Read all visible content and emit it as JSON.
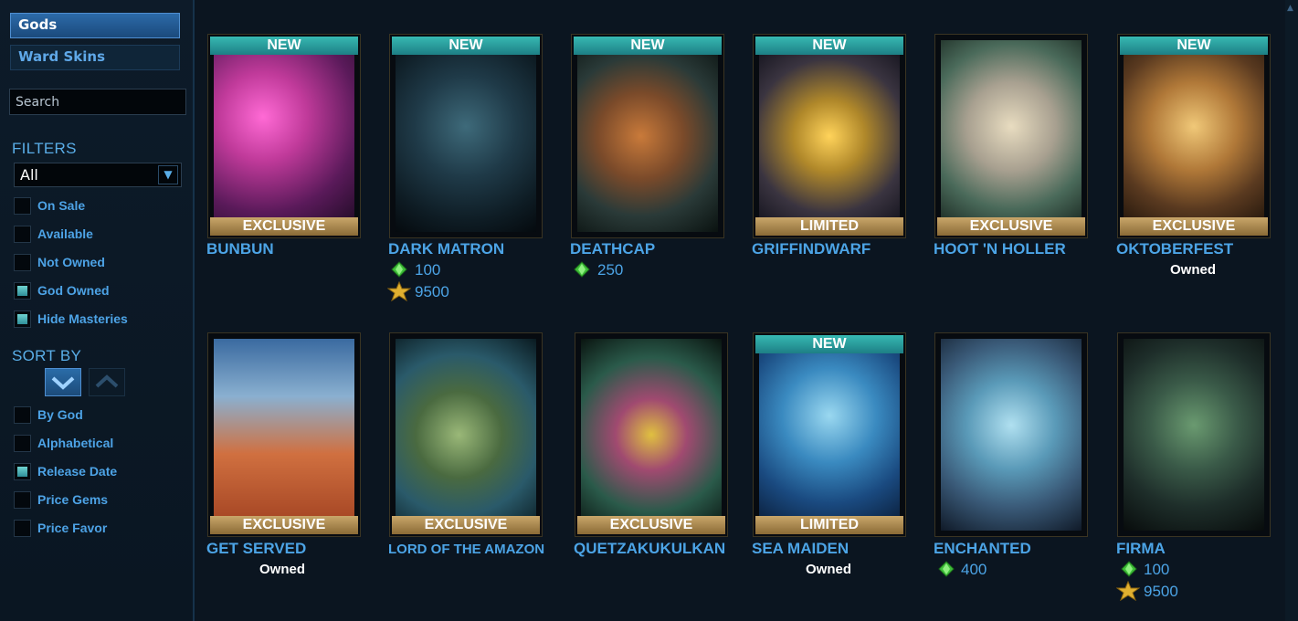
{
  "sidebar": {
    "tabs": [
      {
        "label": "Gods",
        "active": true
      },
      {
        "label": "Ward Skins",
        "active": false
      }
    ],
    "search_placeholder": "Search",
    "filters_title": "FILTERS",
    "filter_dropdown": "All",
    "filter_options": [
      {
        "label": "On Sale",
        "checked": false
      },
      {
        "label": "Available",
        "checked": false
      },
      {
        "label": "Not Owned",
        "checked": false
      },
      {
        "label": "God Owned",
        "checked": true
      },
      {
        "label": "Hide Masteries",
        "checked": true
      }
    ],
    "sort_title": "SORT BY",
    "sort_options": [
      {
        "label": "By God",
        "checked": false
      },
      {
        "label": "Alphabetical",
        "checked": false
      },
      {
        "label": "Release Date",
        "checked": true
      },
      {
        "label": "Price Gems",
        "checked": false
      },
      {
        "label": "Price Favor",
        "checked": false
      }
    ]
  },
  "skins": [
    {
      "name": "BUNBUN",
      "top_banner": "NEW",
      "bottom_banner": "EXCLUSIVE",
      "owned": "",
      "gems": "",
      "favor": ""
    },
    {
      "name": "DARK MATRON",
      "top_banner": "NEW",
      "bottom_banner": "",
      "owned": "",
      "gems": "100",
      "favor": "9500"
    },
    {
      "name": "DEATHCAP",
      "top_banner": "NEW",
      "bottom_banner": "",
      "owned": "",
      "gems": "250",
      "favor": ""
    },
    {
      "name": "GRIFFINDWARF",
      "top_banner": "NEW",
      "bottom_banner": "LIMITED",
      "owned": "",
      "gems": "",
      "favor": ""
    },
    {
      "name": "HOOT 'N HOLLER",
      "top_banner": "",
      "bottom_banner": "EXCLUSIVE",
      "owned": "",
      "gems": "",
      "favor": ""
    },
    {
      "name": "OKTOBERFEST",
      "top_banner": "NEW",
      "bottom_banner": "EXCLUSIVE",
      "owned": "Owned",
      "gems": "",
      "favor": ""
    },
    {
      "name": "GET SERVED",
      "top_banner": "",
      "bottom_banner": "EXCLUSIVE",
      "owned": "Owned",
      "gems": "",
      "favor": ""
    },
    {
      "name": "LORD OF THE AMAZON",
      "top_banner": "",
      "bottom_banner": "EXCLUSIVE",
      "owned": "",
      "gems": "",
      "favor": ""
    },
    {
      "name": "QUETZAKUKULKAN",
      "top_banner": "",
      "bottom_banner": "EXCLUSIVE",
      "owned": "",
      "gems": "",
      "favor": ""
    },
    {
      "name": "SEA MAIDEN",
      "top_banner": "NEW",
      "bottom_banner": "LIMITED",
      "owned": "Owned",
      "gems": "",
      "favor": ""
    },
    {
      "name": "ENCHANTED",
      "top_banner": "",
      "bottom_banner": "",
      "owned": "",
      "gems": "400",
      "favor": ""
    },
    {
      "name": "FIRMA",
      "top_banner": "",
      "bottom_banner": "",
      "owned": "",
      "gems": "100",
      "favor": "9500"
    }
  ],
  "colors": {
    "accent": "#4ca4e6",
    "new_banner": "#2aa39e",
    "gold_banner": "#b08a4e",
    "gem": "#3fbf3a",
    "favor": "#e0b030"
  },
  "icons": [
    "gem-icon",
    "favor-icon",
    "chevron-down-icon",
    "chevron-up-icon"
  ]
}
